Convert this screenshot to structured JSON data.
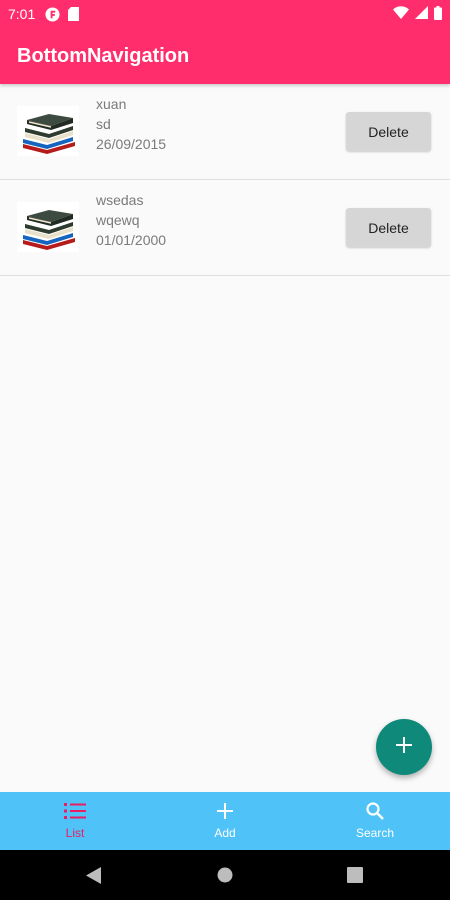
{
  "status_bar": {
    "time": "7:01",
    "icons": [
      "notification-app-icon",
      "sd-card-icon",
      "wifi-icon",
      "signal-icon",
      "battery-icon"
    ]
  },
  "app_bar": {
    "title": "BottomNavigation"
  },
  "items": [
    {
      "title": "xuan",
      "subtitle": "sd",
      "date": "26/09/2015",
      "delete_label": "Delete",
      "thumbnail_icon": "books-icon"
    },
    {
      "title": "wsedas",
      "subtitle": "wqewq",
      "date": "01/01/2000",
      "delete_label": "Delete",
      "thumbnail_icon": "books-icon"
    }
  ],
  "fab": {
    "icon": "add-icon"
  },
  "bottom_nav": {
    "items": [
      {
        "label": "List",
        "icon": "list-icon",
        "active": true
      },
      {
        "label": "Add",
        "icon": "add-icon",
        "active": false
      },
      {
        "label": "Search",
        "icon": "search-icon",
        "active": false
      }
    ]
  },
  "system_nav": {
    "icons": [
      "back-icon",
      "home-icon",
      "recents-icon"
    ]
  },
  "colors": {
    "primary": "#ff2d6b",
    "accent_fab": "#0f8a7a",
    "bottom_nav_bg": "#4fc3f7",
    "active_nav": "#e91e63"
  }
}
